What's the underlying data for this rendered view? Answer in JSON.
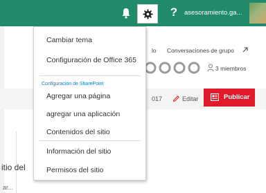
{
  "topbar": {
    "user_name": "asesoramiento.ga...",
    "help_symbol": "?",
    "icons": [
      "bell-icon",
      "gear-icon",
      "help-icon",
      "avatar"
    ]
  },
  "settings_menu": {
    "items": [
      "Cambiar tema",
      "Configuración de Office 365",
      "Agregar una página",
      "agregar una aplicación",
      "Contenidos del sitio",
      "Información del sitio",
      "Permisos del sitio"
    ],
    "section_header": "Configuración de SharePoint"
  },
  "background_page": {
    "fragment_lo": "lo",
    "group_conversations": "Conversaciones de grupo",
    "members_count": "3 miembros",
    "date_fragment": "017",
    "edit_label": "Editar",
    "publish_label": "Publicar",
    "site_fragment": "itio del",
    "bottom_fragment": "ar..."
  },
  "colors": {
    "suite_bar": "#218a6a",
    "publish_button": "#e11a2b",
    "link_blue": "#0a7bbf"
  }
}
